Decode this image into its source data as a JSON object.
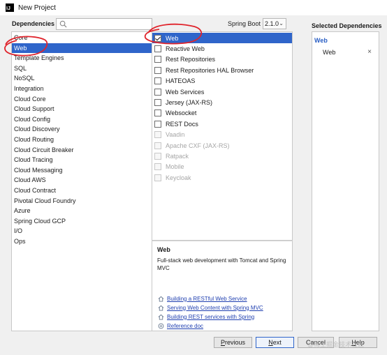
{
  "window": {
    "title": "New Project",
    "icon_text": "IJ"
  },
  "header": {
    "dependencies_label": "Dependencies",
    "search": {
      "value": "",
      "placeholder": ""
    },
    "spring_boot_label": "Spring Boot",
    "spring_boot_version": "2.1.0"
  },
  "categories": [
    "Core",
    "Web",
    "Template Engines",
    "SQL",
    "NoSQL",
    "Integration",
    "Cloud Core",
    "Cloud Support",
    "Cloud Config",
    "Cloud Discovery",
    "Cloud Routing",
    "Cloud Circuit Breaker",
    "Cloud Tracing",
    "Cloud Messaging",
    "Cloud AWS",
    "Cloud Contract",
    "Pivotal Cloud Foundry",
    "Azure",
    "Spring Cloud GCP",
    "I/O",
    "Ops"
  ],
  "selected_category": "Web",
  "dependencies": [
    {
      "label": "Web",
      "checked": true,
      "enabled": true,
      "selected": true
    },
    {
      "label": "Reactive Web",
      "checked": false,
      "enabled": true,
      "selected": false
    },
    {
      "label": "Rest Repositories",
      "checked": false,
      "enabled": true,
      "selected": false
    },
    {
      "label": "Rest Repositories HAL Browser",
      "checked": false,
      "enabled": true,
      "selected": false
    },
    {
      "label": "HATEOAS",
      "checked": false,
      "enabled": true,
      "selected": false
    },
    {
      "label": "Web Services",
      "checked": false,
      "enabled": true,
      "selected": false
    },
    {
      "label": "Jersey (JAX-RS)",
      "checked": false,
      "enabled": true,
      "selected": false
    },
    {
      "label": "Websocket",
      "checked": false,
      "enabled": true,
      "selected": false
    },
    {
      "label": "REST Docs",
      "checked": false,
      "enabled": true,
      "selected": false
    },
    {
      "label": "Vaadin",
      "checked": false,
      "enabled": false,
      "selected": false
    },
    {
      "label": "Apache CXF (JAX-RS)",
      "checked": false,
      "enabled": false,
      "selected": false
    },
    {
      "label": "Ratpack",
      "checked": false,
      "enabled": false,
      "selected": false
    },
    {
      "label": "Mobile",
      "checked": false,
      "enabled": false,
      "selected": false
    },
    {
      "label": "Keycloak",
      "checked": false,
      "enabled": false,
      "selected": false
    }
  ],
  "description": {
    "title": "Web",
    "text": "Full-stack web development with Tomcat and Spring MVC",
    "links": [
      {
        "icon": "guide-icon",
        "label": "Building a RESTful Web Service"
      },
      {
        "icon": "guide-icon",
        "label": "Serving Web Content with Spring MVC"
      },
      {
        "icon": "guide-icon",
        "label": "Building REST services with Spring"
      },
      {
        "icon": "reference-icon",
        "label": "Reference doc"
      }
    ]
  },
  "selected_dependencies": {
    "title": "Selected Dependencies",
    "groups": [
      {
        "name": "Web",
        "items": [
          "Web"
        ]
      }
    ],
    "remove_glyph": "×"
  },
  "buttons": {
    "previous": "Previous",
    "next": "Next",
    "cancel": "Cancel",
    "help": "Help"
  },
  "watermark": "@稀土掘金技术社区",
  "colors": {
    "selection": "#2f65ca",
    "link": "#1f3fb0",
    "annotation": "#e0232b",
    "group_title": "#2a5fc4"
  }
}
